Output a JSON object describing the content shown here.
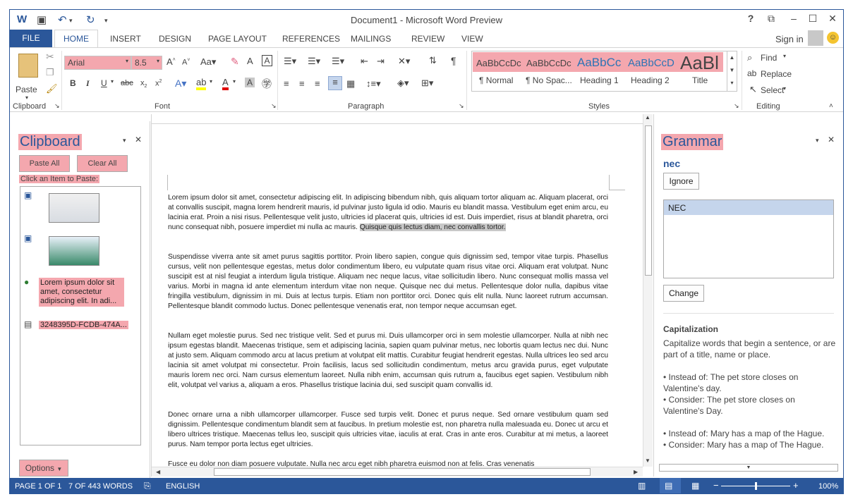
{
  "window": {
    "title": "Document1 - Microsoft Word Preview",
    "help": "?",
    "restore": "⧉",
    "minimize": "–",
    "maximize": "☐",
    "close": "✕",
    "sign_in": "Sign in"
  },
  "tabs": [
    "FILE",
    "HOME",
    "INSERT",
    "DESIGN",
    "PAGE LAYOUT",
    "REFERENCES",
    "MAILINGS",
    "REVIEW",
    "VIEW"
  ],
  "ribbon": {
    "clipboard": {
      "label": "Clipboard",
      "paste": "Paste"
    },
    "font": {
      "label": "Font",
      "name": "Arial",
      "size": "8.5"
    },
    "paragraph": {
      "label": "Paragraph"
    },
    "styles": {
      "label": "Styles",
      "items": [
        {
          "preview": "AaBbCcDc",
          "name": "¶ Normal"
        },
        {
          "preview": "AaBbCcDc",
          "name": "¶ No Spac..."
        },
        {
          "preview": "AaBbCc",
          "name": "Heading 1"
        },
        {
          "preview": "AaBbCcD",
          "name": "Heading 2"
        },
        {
          "preview": "AaBl",
          "name": "Title"
        }
      ]
    },
    "editing": {
      "label": "Editing",
      "find": "Find",
      "replace": "Replace",
      "select": "Select"
    }
  },
  "clipboard_pane": {
    "title": "Clipboard",
    "paste_all": "Paste All",
    "clear_all": "Clear All",
    "hint": "Click an Item to Paste:",
    "text_item": "Lorem ipsum dolor sit amet, consectetur adipiscing elit. In adi...",
    "guid_item": "3248395D-FCDB-474A...",
    "options": "Options"
  },
  "grammar_pane": {
    "title": "Grammar",
    "word": "nec",
    "ignore": "Ignore",
    "suggestion": "NEC",
    "change": "Change",
    "rule_title": "Capitalization",
    "rule_desc": "Capitalize words that begin a sentence, or are part of a title, name or place.",
    "ex1a": "• Instead of: The pet store closes on Valentine's day.",
    "ex1b": "• Consider: The pet store closes on Valentine's Day.",
    "ex2a": "• Instead of: Mary has a map of the Hague.",
    "ex2b": "• Consider: Mary has a map of The Hague."
  },
  "document": {
    "p1": "Lorem ipsum dolor sit amet, consectetur adipiscing elit. In adipiscing bibendum nibh, quis aliquam tortor aliquam ac. Aliquam placerat, orci at convallis suscipit, magna lorem hendrerit mauris, id pulvinar justo ligula id odio. Mauris eu blandit massa. Vestibulum eget enim arcu, eu lacinia erat. Proin a nisi risus. Pellentesque velit justo, ultricies id placerat quis, ultricies id est. Duis imperdiet, risus at blandit pharetra, orci nunc consequat nibh, posuere imperdiet mi nulla ac mauris.",
    "p1_sel": "Quisque quis lectus diam, nec convallis tortor.",
    "p2": "Suspendisse viverra ante sit amet purus sagittis porttitor. Proin libero sapien, congue quis dignissim sed, tempor vitae turpis. Phasellus cursus, velit non pellentesque egestas, metus dolor condimentum libero, eu vulputate quam risus vitae orci. Aliquam erat volutpat. Nunc suscipit est at nisl feugiat a interdum ligula tristique. Aliquam nec neque lacus, vitae sollicitudin libero. Nunc consequat mollis massa vel varius. Morbi in magna id ante elementum interdum vitae non neque. Quisque nec dui metus. Pellentesque dolor nulla, dapibus vitae fringilla vestibulum, dignissim in mi. Duis at lectus turpis. Etiam non porttitor orci. Donec quis elit nulla. Nunc laoreet rutrum accumsan. Pellentesque blandit commodo luctus. Donec pellentesque venenatis erat, non tempor neque accumsan eget.",
    "p3": "Nullam eget molestie purus. Sed nec tristique velit. Sed et purus mi. Duis ullamcorper orci in sem molestie ullamcorper. Nulla at nibh nec ipsum egestas blandit. Maecenas tristique, sem et adipiscing lacinia, sapien quam pulvinar metus, nec lobortis quam lectus nec dui. Nunc at justo sem. Aliquam commodo arcu at lacus pretium at volutpat elit mattis. Curabitur feugiat hendrerit egestas. Nulla ultrices leo sed arcu lacinia sit amet volutpat mi consectetur. Proin facilisis, lacus sed sollicitudin condimentum, metus arcu gravida purus, eget vulputate mauris lorem nec orci. Nam cursus elementum laoreet. Nulla nibh enim, accumsan quis rutrum a, faucibus eget sapien. Vestibulum nibh elit, volutpat vel varius a, aliquam a eros. Phasellus tristique lacinia dui, sed suscipit quam convallis id.",
    "p4": "Donec ornare urna a nibh ullamcorper ullamcorper. Fusce sed turpis velit. Donec et purus neque. Sed ornare vestibulum quam sed dignissim. Pellentesque condimentum blandit sem at faucibus. In pretium molestie est, non pharetra nulla malesuada eu. Donec ut arcu et libero ultrices tristique. Maecenas tellus leo, suscipit quis ultricies vitae, iaculis at erat. Cras in ante eros. Curabitur at mi metus, a laoreet purus. Nam tempor porta lectus eget ultricies.",
    "p5": "Fusce eu dolor non diam posuere vulputate. Nulla nec arcu eget nibh pharetra euismod non at felis. Cras venenatis"
  },
  "status": {
    "page": "PAGE 1 OF 1",
    "words": "7 OF 443 WORDS",
    "language": "ENGLISH",
    "zoom": "100%"
  }
}
